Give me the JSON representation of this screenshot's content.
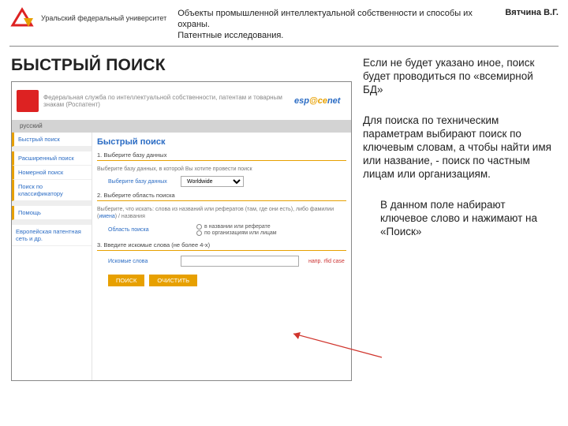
{
  "header": {
    "logo_text": "Уральский\nфедеральный\nуниверситет",
    "subtitle_l1": "Объекты промышленной интеллектуальной собственности и способы их охраны.",
    "subtitle_l2": "Патентные исследования.",
    "author": "Вятчина В.Г."
  },
  "title": "БЫСТРЫЙ ПОИСК",
  "shot": {
    "banner_text": "Федеральная служба по интеллектуальной собственности, патентам и товарным знакам (Роспатент)",
    "banner_logo_a": "esp",
    "banner_logo_b": "@ce",
    "banner_logo_c": "net",
    "tab": "русский",
    "sidebar": {
      "s1": "Быстрый поиск",
      "s2": "Расширенный поиск",
      "s3": "Номерной поиск",
      "s4": "Поиск по классификатору",
      "s5": "Помощь",
      "s6": "Европейская патентная сеть и др."
    },
    "ctitle": "Быстрый поиск",
    "step1": "1. Выберите базу данных",
    "desc1": "Выберите базу данных, в которой Вы хотите провести поиск",
    "field1_label": "Выберите базу данных",
    "field1_value": "Worldwide",
    "step2": "2. Выберите область поиска",
    "desc2_a": "Выберите, что искать: слова из названий или рефератов (там, где они есть), либо фамилии (",
    "desc2_link": "имена",
    "desc2_b": ") / названия",
    "field2_label": "Область поиска",
    "radio1": "в названии или реферате",
    "radio2": "по организациям или лицам",
    "step3": "3. Введите искомые слова (не более 4-х)",
    "field3_label": "Искомые слова",
    "eg3": "напр. rfid case",
    "btn_search": "ПОИСК",
    "btn_clear": "ОЧИСТИТЬ"
  },
  "right": {
    "p1": "Если не будет указано иное, поиск будет проводиться по «всемирной БД»",
    "p2": "Для поиска по техническим параметрам выбирают поиск по ключевым словам, а чтобы найти имя или название, - поиск по частным лицам или организациям.",
    "p3": "В данном поле набирают ключевое слово и нажимают на «Поиск»"
  }
}
